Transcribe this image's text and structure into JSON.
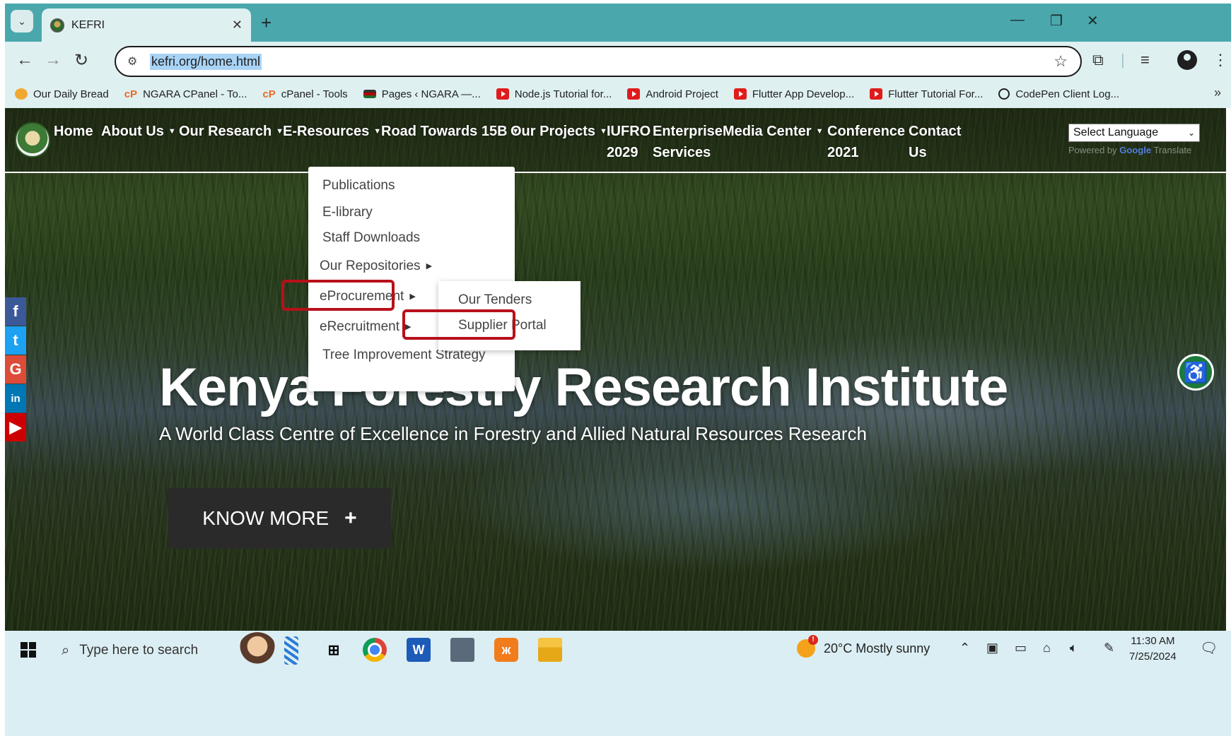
{
  "browser": {
    "tab_title": "KEFRI",
    "new_tab": "+",
    "url": "kefri.org/home.html",
    "bookmarks": [
      {
        "label": "Our Daily Bread",
        "icon": "odb"
      },
      {
        "label": "NGARA CPanel - To...",
        "icon": "cp"
      },
      {
        "label": "cPanel - Tools",
        "icon": "cp"
      },
      {
        "label": "Pages ‹ NGARA —...",
        "icon": "ng"
      },
      {
        "label": "Node.js Tutorial for...",
        "icon": "yt"
      },
      {
        "label": "Android Project",
        "icon": "yt"
      },
      {
        "label": "Flutter App Develop...",
        "icon": "yt"
      },
      {
        "label": "Flutter Tutorial For...",
        "icon": "yt"
      },
      {
        "label": "CodePen Client Log...",
        "icon": "codepen"
      }
    ]
  },
  "site": {
    "nav": [
      {
        "label": "Home",
        "caret": false
      },
      {
        "label": "About Us",
        "caret": true
      },
      {
        "label": "Our Research",
        "caret": true
      },
      {
        "label": "E-Resources",
        "caret": true
      },
      {
        "label": "Road Towards 15B",
        "caret": true
      },
      {
        "label": "Our Projects",
        "caret": true
      },
      {
        "label": "IUFRO\n2029",
        "caret": false
      },
      {
        "label": "Enterprise\nServices",
        "caret": false
      },
      {
        "label": "Media Center",
        "caret": true
      },
      {
        "label": "Conference\n2021",
        "caret": false
      },
      {
        "label": "Contact\nUs",
        "caret": false
      }
    ],
    "language_select": "Select Language",
    "powered_by": "Powered by",
    "powered_google": "Google",
    "powered_translate": "Translate",
    "dropdown": [
      {
        "label": "Publications",
        "submenu": false
      },
      {
        "label": "E-library",
        "submenu": false
      },
      {
        "label": "Staff Downloads",
        "submenu": false
      },
      {
        "label": "Our Repositories",
        "submenu": true
      },
      {
        "label": "eProcurement",
        "submenu": true
      },
      {
        "label": "eRecruitment",
        "submenu": true
      },
      {
        "label": "Tree Improvement Strategy",
        "submenu": false
      }
    ],
    "submenu": [
      {
        "label": "Our Tenders"
      },
      {
        "label": "Supplier Portal"
      }
    ],
    "hero_title": "Kenya Forestry Research Institute",
    "hero_subtitle": "A World Class Centre of Excellence in Forestry and Allied Natural Resources Research",
    "cta_label": "KNOW MORE",
    "cta_plus": "+",
    "social": [
      "f",
      "t",
      "G",
      "in",
      "▶"
    ],
    "colors": {
      "highlight": "#b8101a",
      "cta_bg": "#2a2a2a",
      "a11y": "#1c7a3a"
    }
  },
  "taskbar": {
    "search_placeholder": "Type here to search",
    "weather": "20°C  Mostly sunny",
    "time": "11:30 AM",
    "date": "7/25/2024"
  }
}
